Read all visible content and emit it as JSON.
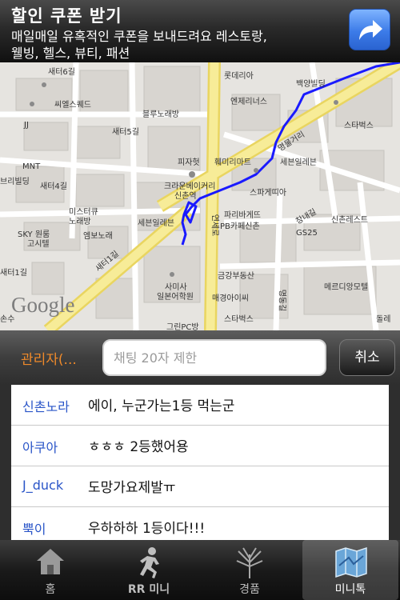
{
  "ad": {
    "title": "할인 쿠폰 받기",
    "line1": "매일매일 유혹적인 쿠폰을 보내드려요 레스토랑,",
    "line2": "웰빙, 헬스, 뷰티, 패션",
    "button_icon": "share-arrow-icon"
  },
  "map": {
    "logo": "Google",
    "labels": {
      "saeteo6": "새터6길",
      "lotte": "롯데리아",
      "baekyang": "백양빌딩",
      "ssi": "씨엘스퀘드",
      "blue": "블루노래방",
      "entry": "엔제리너스",
      "jj": "JJ",
      "saeteo5": "새터5길",
      "starbucks1": "스타벅스",
      "myeongmul": "명물거리",
      "pizza": "피자헛",
      "family": "훼미리마트",
      "seven1": "세븐일레븐",
      "mnt": "MNT",
      "saeteo4": "새터4길",
      "brilliant": "브리빌딩",
      "crown": "크라운베이커리",
      "sinchon_stn": "신촌역",
      "spa": "스파게띠아",
      "mister": "미스터큐",
      "noraebang": "노래방",
      "seven2": "세븐일레븐",
      "yonsei": "연세로",
      "paris": "파리바게뜨",
      "pb": "PB카페신촌",
      "changnae": "창내길",
      "gs25": "GS25",
      "sinchon_rest": "신촌레스트",
      "sky": "SKY 원룸",
      "gosi": "고시텔",
      "embo": "엠보노래",
      "saeteo1a": "새터1길",
      "saeteo1b": "새터1길",
      "samisa": "사미사",
      "ilbon": "일본어학원",
      "geumgang": "금강부동산",
      "merch": "메르디앙모텔",
      "marketaime": "매경아이씨",
      "myungdong": "명동길",
      "starbucks2": "스타벅스",
      "gurin": "그린PC방",
      "ssonsu": "손수",
      "dolle": "돌레"
    },
    "route_color": "#1a1aff",
    "road_color": "#f4e57a"
  },
  "input_bar": {
    "admin_label": "관리자(...",
    "placeholder": "채팅 20자 제한",
    "cancel_label": "취소"
  },
  "messages": [
    {
      "nick": "신촌노라",
      "text": "에이, 누군가는1등 먹는군"
    },
    {
      "nick": "아쿠아",
      "text": "ㅎㅎㅎ 2등했어용"
    },
    {
      "nick": "J_duck",
      "text": "도망가요제발ㅠ"
    },
    {
      "nick": "뿍이",
      "text": "우하하하 1등이다!!!"
    }
  ],
  "tabs": [
    {
      "label": "홈",
      "icon": "home-icon"
    },
    {
      "label": "RR 미니",
      "icon": "runner-icon"
    },
    {
      "label": "경품",
      "icon": "fireworks-icon"
    },
    {
      "label": "미니톡",
      "icon": "map-icon",
      "active": true
    }
  ]
}
